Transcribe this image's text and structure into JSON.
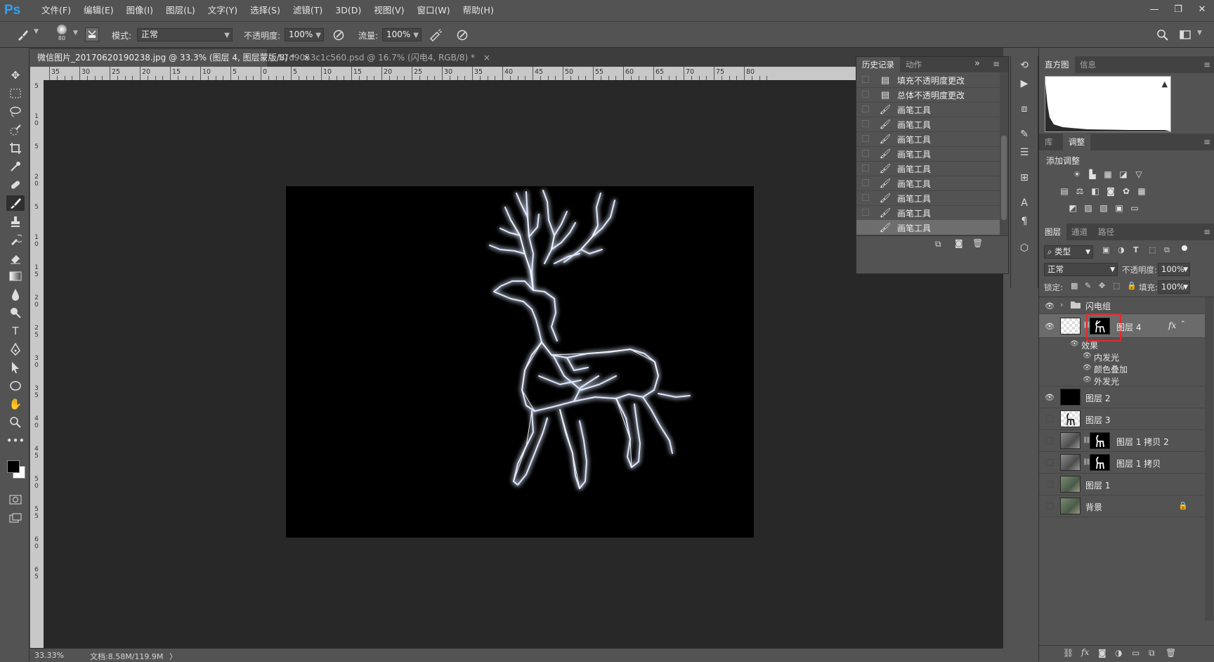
{
  "app": {
    "logo": "Ps"
  },
  "menu": [
    "文件(F)",
    "编辑(E)",
    "图像(I)",
    "图层(L)",
    "文字(Y)",
    "选择(S)",
    "滤镜(T)",
    "3D(D)",
    "视图(V)",
    "窗口(W)",
    "帮助(H)"
  ],
  "window_controls": {
    "minimize": "—",
    "restore": "❐",
    "close": "✕"
  },
  "options": {
    "brush_size": "80",
    "mode_label": "模式:",
    "mode_value": "正常",
    "opacity_label": "不透明度:",
    "opacity_value": "100%",
    "flow_label": "流量:",
    "flow_value": "100%"
  },
  "tabs": [
    {
      "title": "微信图片_20170620190238.jpg @ 33.3% (图层 4, 图层蒙版/8) *",
      "close": "×"
    },
    {
      "title": "57d9053c1c560.psd @ 16.7% (闪电4, RGB/8) *",
      "close": "×"
    }
  ],
  "ruler": {
    "h_labels": [
      "35",
      "30",
      "25",
      "20",
      "15",
      "10",
      "5",
      "0",
      "5",
      "10",
      "15",
      "20",
      "25",
      "30",
      "35",
      "40",
      "45",
      "50",
      "55",
      "60",
      "65",
      "70",
      "75",
      "80"
    ],
    "v_labels": [
      "5",
      "1 0",
      "5",
      "2 0",
      "5",
      "1 0",
      "1 5",
      "2 0",
      "2 5",
      "3 0",
      "3 5",
      "4 0",
      "4 5",
      "5 0",
      "5 5",
      "6 0",
      "6 5"
    ]
  },
  "status": {
    "zoom": "33.33%",
    "doc": "文档:8.58M/119.9M",
    "arrow": "〉"
  },
  "history": {
    "tabs": [
      "历史记录",
      "动作"
    ],
    "expand": "»",
    "items": [
      {
        "label": "填充不透明度更改",
        "icon": "doc-icon"
      },
      {
        "label": "总体不透明度更改",
        "icon": "doc-icon"
      },
      {
        "label": "画笔工具",
        "icon": "brush-icon"
      },
      {
        "label": "画笔工具",
        "icon": "brush-icon"
      },
      {
        "label": "画笔工具",
        "icon": "brush-icon"
      },
      {
        "label": "画笔工具",
        "icon": "brush-icon"
      },
      {
        "label": "画笔工具",
        "icon": "brush-icon"
      },
      {
        "label": "画笔工具",
        "icon": "brush-icon"
      },
      {
        "label": "画笔工具",
        "icon": "brush-icon"
      },
      {
        "label": "画笔工具",
        "icon": "brush-icon"
      },
      {
        "label": "画笔工具",
        "icon": "brush-icon"
      }
    ],
    "selected_index": 10
  },
  "histogram": {
    "tabs": [
      "直方图",
      "信息"
    ],
    "warning": "▲"
  },
  "adjust": {
    "tabs": [
      "库",
      "调整"
    ],
    "title": "添加调整"
  },
  "layers": {
    "tabs": [
      "图层",
      "通道",
      "路径"
    ],
    "filter_label": "类型",
    "blend_mode": "正常",
    "opacity_label": "不透明度:",
    "opacity_value": "100%",
    "lock_label": "锁定:",
    "fill_label": "填充:",
    "fill_value": "100%",
    "group_name": "闪电组",
    "selected_layer": "图层 4",
    "fx": "fx",
    "effects_title": "效果",
    "effects": [
      "内发光",
      "颜色叠加",
      "外发光"
    ],
    "rows": [
      {
        "name": "图层 2",
        "visible": true
      },
      {
        "name": "图层 3",
        "visible": false
      },
      {
        "name": "图层 1 拷贝 2",
        "visible": false
      },
      {
        "name": "图层 1 拷贝",
        "visible": false
      },
      {
        "name": "图层 1",
        "visible": false
      },
      {
        "name": "背景",
        "visible": false
      }
    ]
  },
  "colors": {
    "ui_bg": "#535353",
    "pasteboard": "#282828",
    "logo": "#2fa3f6",
    "highlight_box": "#e8262b",
    "lightning": "#cfe0ff"
  }
}
